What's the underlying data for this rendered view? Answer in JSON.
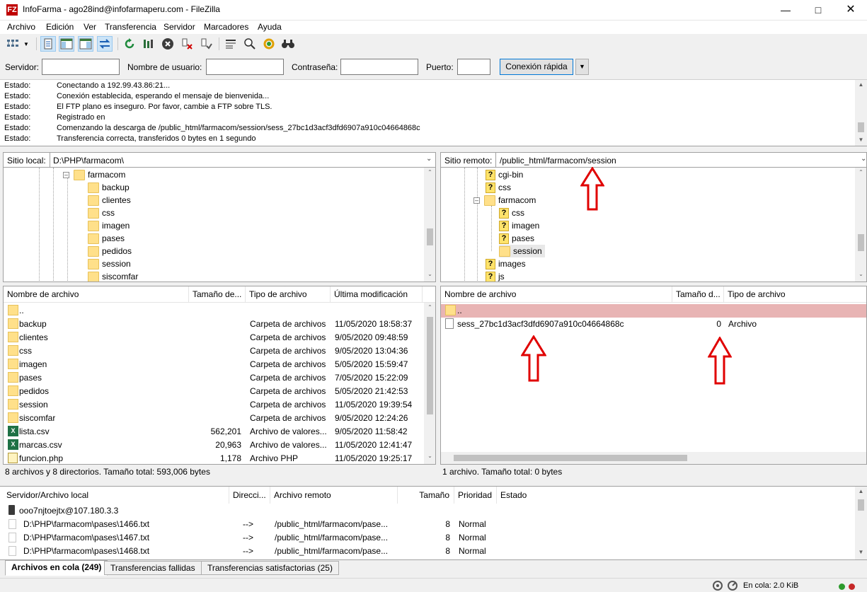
{
  "window": {
    "app_icon": "FZ",
    "title": "InfoFarma - ago28ind@infofarmaperu.com - FileZilla"
  },
  "menu": [
    "Archivo",
    "Edición",
    "Ver",
    "Transferencia",
    "Servidor",
    "Marcadores",
    "Ayuda"
  ],
  "toolbar": {
    "icons": [
      "site-manager-icon",
      "toggle-log-icon",
      "toggle-local-tree-icon",
      "toggle-remote-tree-icon",
      "toggle-queue-icon",
      "refresh-icon",
      "process-queue-icon",
      "cancel-icon",
      "disconnect-icon",
      "reconnect-icon",
      "filter-icon",
      "compare-icon",
      "sync-browse-icon",
      "search-icon"
    ]
  },
  "quickconnect": {
    "server_label": "Servidor:",
    "user_label": "Nombre de usuario:",
    "pass_label": "Contraseña:",
    "port_label": "Puerto:",
    "server_value": "",
    "user_value": "",
    "pass_value": "",
    "port_value": "",
    "connect_label": "Conexión rápida"
  },
  "log": [
    {
      "type": "Estado:",
      "msg": "Conectando a 192.99.43.86:21..."
    },
    {
      "type": "Estado:",
      "msg": "Conexión establecida, esperando el mensaje de bienvenida..."
    },
    {
      "type": "Estado:",
      "msg": "El FTP plano es inseguro. Por favor, cambie a FTP sobre TLS."
    },
    {
      "type": "Estado:",
      "msg": "Registrado en"
    },
    {
      "type": "Estado:",
      "msg": "Comenzando la descarga de /public_html/farmacom/session/sess_27bc1d3acf3dfd6907a910c04664868c"
    },
    {
      "type": "Estado:",
      "msg": "Transferencia correcta, transferidos 0 bytes en 1 segundo"
    }
  ],
  "local": {
    "site_label": "Sitio local:",
    "path": "D:\\PHP\\farmacom\\",
    "tree_parent": "farmacom",
    "tree_children": [
      "backup",
      "clientes",
      "css",
      "imagen",
      "pases",
      "pedidos",
      "session",
      "siscomfar"
    ],
    "columns": [
      "Nombre de archivo",
      "Tamaño de...",
      "Tipo de archivo",
      "Última modificación"
    ],
    "files": [
      {
        "name": "..",
        "size": "",
        "type": "",
        "modified": "",
        "icon": "folder"
      },
      {
        "name": "backup",
        "size": "",
        "type": "Carpeta de archivos",
        "modified": "11/05/2020 18:58:37",
        "icon": "folder"
      },
      {
        "name": "clientes",
        "size": "",
        "type": "Carpeta de archivos",
        "modified": "9/05/2020 09:48:59",
        "icon": "folder"
      },
      {
        "name": "css",
        "size": "",
        "type": "Carpeta de archivos",
        "modified": "9/05/2020 13:04:36",
        "icon": "folder"
      },
      {
        "name": "imagen",
        "size": "",
        "type": "Carpeta de archivos",
        "modified": "5/05/2020 15:59:47",
        "icon": "folder"
      },
      {
        "name": "pases",
        "size": "",
        "type": "Carpeta de archivos",
        "modified": "7/05/2020 15:22:09",
        "icon": "folder"
      },
      {
        "name": "pedidos",
        "size": "",
        "type": "Carpeta de archivos",
        "modified": "5/05/2020 21:42:53",
        "icon": "folder"
      },
      {
        "name": "session",
        "size": "",
        "type": "Carpeta de archivos",
        "modified": "11/05/2020 19:39:54",
        "icon": "folder"
      },
      {
        "name": "siscomfar",
        "size": "",
        "type": "Carpeta de archivos",
        "modified": "9/05/2020 12:24:26",
        "icon": "folder"
      },
      {
        "name": "lista.csv",
        "size": "562,201",
        "type": "Archivo de valores...",
        "modified": "9/05/2020 11:58:42",
        "icon": "xls"
      },
      {
        "name": "marcas.csv",
        "size": "20,963",
        "type": "Archivo de valores...",
        "modified": "11/05/2020 12:41:47",
        "icon": "xls"
      },
      {
        "name": "funcion.php",
        "size": "1,178",
        "type": "Archivo PHP",
        "modified": "11/05/2020 19:25:17",
        "icon": "php"
      }
    ],
    "status": "8 archivos y 8 directorios. Tamaño total: 593,006 bytes"
  },
  "remote": {
    "site_label": "Sitio remoto:",
    "path": "/public_html/farmacom/session",
    "tree": [
      {
        "label": "cgi-bin",
        "icon": "q",
        "level": 0
      },
      {
        "label": "css",
        "icon": "q",
        "level": 0
      },
      {
        "label": "farmacom",
        "icon": "folder",
        "level": 0,
        "expanded": true
      },
      {
        "label": "css",
        "icon": "q",
        "level": 1
      },
      {
        "label": "imagen",
        "icon": "q",
        "level": 1
      },
      {
        "label": "pases",
        "icon": "q",
        "level": 1
      },
      {
        "label": "session",
        "icon": "folder",
        "level": 1,
        "selected": true
      },
      {
        "label": "images",
        "icon": "q",
        "level": 0
      },
      {
        "label": "js",
        "icon": "q",
        "level": 0
      }
    ],
    "q_glyph": "?",
    "columns": [
      "Nombre de archivo",
      "Tamaño d...",
      "Tipo de archivo"
    ],
    "files": [
      {
        "name": "..",
        "size": "",
        "type": "",
        "icon": "folder",
        "highlight": true
      },
      {
        "name": "sess_27bc1d3acf3dfd6907a910c04664868c",
        "size": "0",
        "type": "Archivo",
        "icon": "file"
      }
    ],
    "status": "1 archivo. Tamaño total: 0 bytes"
  },
  "queue": {
    "columns": [
      "Servidor/Archivo local",
      "Direcci...",
      "Archivo remoto",
      "Tamaño",
      "Prioridad",
      "Estado"
    ],
    "server": "ooo7njtoejtx@107.180.3.3",
    "items": [
      {
        "local": "D:\\PHP\\farmacom\\pases\\1466.txt",
        "dir": "-->",
        "remote": "/public_html/farmacom/pase...",
        "size": "8",
        "priority": "Normal"
      },
      {
        "local": "D:\\PHP\\farmacom\\pases\\1467.txt",
        "dir": "-->",
        "remote": "/public_html/farmacom/pase...",
        "size": "8",
        "priority": "Normal"
      },
      {
        "local": "D:\\PHP\\farmacom\\pases\\1468.txt",
        "dir": "-->",
        "remote": "/public_html/farmacom/pase...",
        "size": "8",
        "priority": "Normal"
      }
    ]
  },
  "tabs": [
    "Archivos en cola (249)",
    "Transferencias fallidas",
    "Transferencias satisfactorias (25)"
  ],
  "bottom": {
    "queue_status": "En cola: 2.0 KiB",
    "led_colors": [
      "#2e9b2e",
      "#c62828"
    ]
  },
  "colors": {
    "highlight_row": "#e8b4b4",
    "annotation_arrow": "#e00000",
    "selection": "#cce8ff"
  }
}
